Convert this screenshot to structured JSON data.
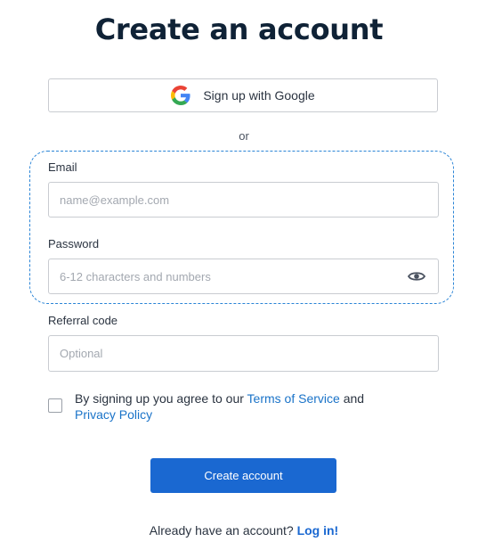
{
  "page_title": "Create an account",
  "google_button": {
    "label": "Sign up with Google",
    "icon": "google-logo"
  },
  "divider_text": "or",
  "email": {
    "label": "Email",
    "placeholder": "name@example.com",
    "value": ""
  },
  "password": {
    "label": "Password",
    "placeholder": "6-12 characters and numbers",
    "value": "",
    "toggle_icon": "eye-icon"
  },
  "referral": {
    "label": "Referral code",
    "placeholder": "Optional",
    "value": ""
  },
  "terms": {
    "checked": false,
    "prefix": "By signing up you agree to our",
    "tos_link": "Terms of Service",
    "conjunction": "and",
    "privacy_link": "Privacy Policy"
  },
  "create_button": {
    "label": "Create account"
  },
  "login": {
    "prompt": "Already have an account?",
    "link": "Log in!"
  },
  "colors": {
    "primary": "#1a68d1",
    "link": "#1a73c8",
    "focus_outline": "#2a84d6",
    "title": "#0f2236"
  }
}
